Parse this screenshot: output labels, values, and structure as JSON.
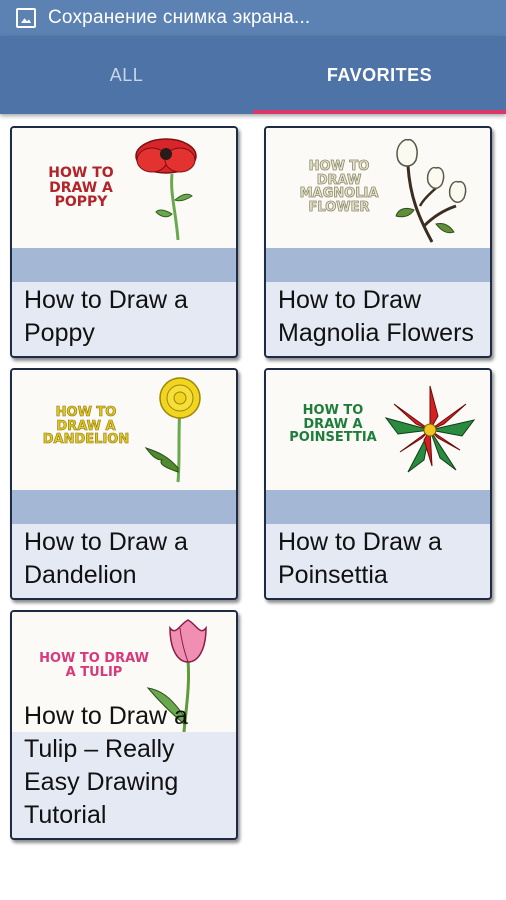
{
  "status_bar": {
    "icon": "screenshot-icon",
    "text": "Сохранение снимка экрана..."
  },
  "tabs": [
    {
      "label": "ALL",
      "active": false
    },
    {
      "label": "FAVORITES",
      "active": true
    }
  ],
  "colors": {
    "status_bar": "#5b82b2",
    "tab_bar": "#4d73a7",
    "tab_indicator": "#d8396b",
    "card_band": "#a4b8d6",
    "card_body": "#e4e9f3"
  },
  "cards": [
    {
      "thumb_text": "HOW TO DRAW A POPPY",
      "thumb_lines": [
        "HOW TO",
        "DRAW A",
        "POPPY"
      ],
      "title": "How to Draw a Poppy",
      "thumb_color": "#b3232a",
      "art": "poppy"
    },
    {
      "thumb_text": "HOW TO DRAW MAGNOLIA FLOWER",
      "thumb_lines": [
        "HOW TO",
        "DRAW",
        "MAGNOLIA",
        "FLOWER"
      ],
      "title": "How to Draw Magnolia Flowers",
      "thumb_color": "#e9e6cf",
      "art": "magnolia"
    },
    {
      "thumb_text": "HOW TO DRAW A DANDELION",
      "thumb_lines": [
        "HOW TO",
        "DRAW A",
        "DANDELION"
      ],
      "title": "How to Draw a Dandelion",
      "thumb_color": "#e3c81f",
      "art": "dandelion"
    },
    {
      "thumb_text": "HOW TO DRAW A POINSETTIA",
      "thumb_lines": [
        "HOW TO",
        "DRAW A",
        "POINSETTIA"
      ],
      "title": "How to Draw a Poinsettia",
      "thumb_color": "#1e7d3a",
      "art": "poinsettia"
    },
    {
      "thumb_text": "HOW TO DRAW A TULIP",
      "thumb_lines": [
        "HOW TO DRAW",
        "A TULIP"
      ],
      "title": "How to Draw a Tulip – Really Easy Drawing Tutorial",
      "thumb_color": "#d8397a",
      "art": "tulip"
    }
  ]
}
